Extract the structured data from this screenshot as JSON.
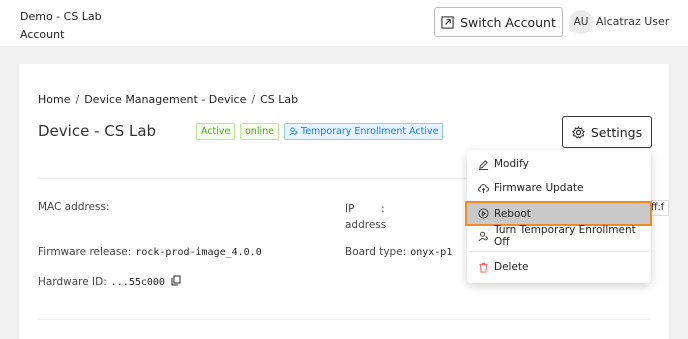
{
  "header": {
    "org_line1": "Demo - CS Lab",
    "org_line2": "Account",
    "switch_account_label": "Switch Account",
    "avatar_initials": "AU",
    "user_name": "Alcatraz User"
  },
  "breadcrumb": {
    "items": [
      "Home",
      "Device Management - Device",
      "CS Lab"
    ]
  },
  "device": {
    "title": "Device - CS Lab",
    "tags": [
      "Active",
      "online",
      "Temporary Enrollment Active"
    ],
    "settings_label": "Settings"
  },
  "fields": {
    "mac_label": "MAC address:",
    "mac_value": "",
    "ip_label_line1": "IP        :",
    "ip_label_line2": "address",
    "ip_value_partial": "ff:f",
    "firmware_label": "Firmware release:",
    "firmware_value": "rock-prod-image_4.0.0",
    "board_label": "Board type:",
    "board_value": "onyx-p1",
    "hardware_label": "Hardware ID:",
    "hardware_value": "...55c000"
  },
  "menu": {
    "items": [
      {
        "label": "Modify",
        "icon": "edit-icon"
      },
      {
        "label": "Firmware Update",
        "icon": "cloud-upload-icon"
      },
      {
        "label": "Reboot",
        "icon": "play-circle-icon"
      },
      {
        "label": "Turn Temporary Enrollment Off",
        "icon": "user-switch-icon"
      },
      {
        "label": "Delete",
        "icon": "trash-icon"
      }
    ],
    "highlighted_item": "Reboot",
    "highlight_color": "#f08a24"
  },
  "colors": {
    "tag_green": "#52a41a",
    "tag_blue": "#1677ff",
    "delete_icon": "#ff4d4f"
  }
}
